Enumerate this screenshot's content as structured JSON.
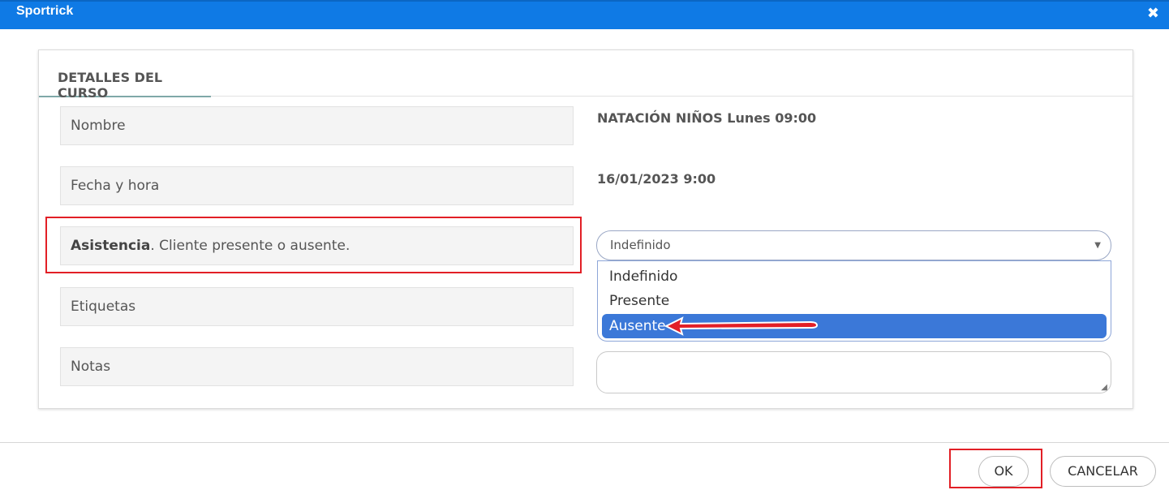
{
  "window": {
    "title": "Sportrick",
    "close_symbol": "✖"
  },
  "tab": {
    "label": "DETALLES DEL CURSO"
  },
  "fields": {
    "nombre": {
      "label": "Nombre",
      "value": "NATACIÓN NIÑOS Lunes 09:00"
    },
    "fecha": {
      "label": "Fecha y hora",
      "value": "16/01/2023 9:00"
    },
    "asistencia": {
      "label_bold": "Asistencia",
      "label_rest": ". Cliente presente o ausente.",
      "selected": "Indefinido"
    },
    "etiquetas": {
      "label": "Etiquetas"
    },
    "notas": {
      "label": "Notas"
    }
  },
  "dropdown": {
    "options": [
      "Indefinido",
      "Presente",
      "Ausente"
    ],
    "highlighted": "Ausente"
  },
  "footer": {
    "ok_label": "OK",
    "cancel_label": "CANCELAR"
  },
  "colors": {
    "titlebar": "#0f7ae5",
    "highlight": "#e21f26",
    "selected_option": "#3b78d8"
  }
}
